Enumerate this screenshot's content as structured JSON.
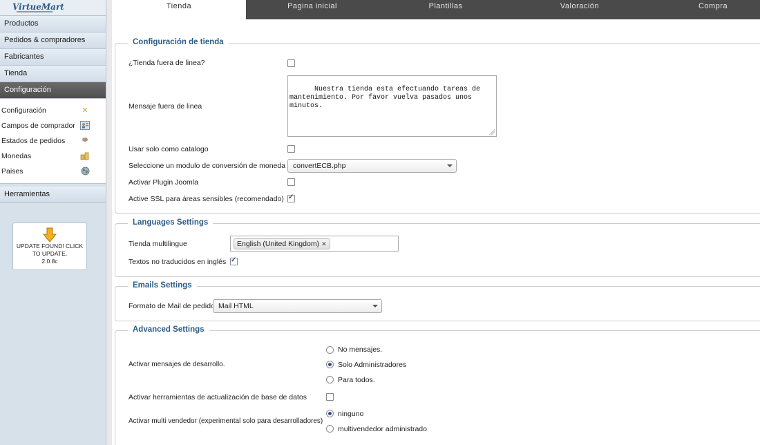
{
  "sidebar": {
    "logo": "VirtueMart",
    "menu": [
      {
        "label": "Productos"
      },
      {
        "label": "Pedidos & compradores"
      },
      {
        "label": "Fabricantes"
      },
      {
        "label": "Tienda"
      },
      {
        "label": "Configuración"
      }
    ],
    "submenu": [
      {
        "label": "Configuración",
        "icon": "tools-icon"
      },
      {
        "label": "Campos de comprador",
        "icon": "user-fields-icon"
      },
      {
        "label": "Estados de pedidos",
        "icon": "order-status-icon"
      },
      {
        "label": "Monedas",
        "icon": "coins-icon"
      },
      {
        "label": "Paises",
        "icon": "globe-icon"
      }
    ],
    "tools_label": "Herramientas",
    "update": {
      "line1": "UPDATE FOUND! CLICK",
      "line2": "TO UPDATE.",
      "version": "2.0.8c"
    }
  },
  "tabs": [
    {
      "label": "Tienda"
    },
    {
      "label": "Pagina inicial"
    },
    {
      "label": "Plantillas"
    },
    {
      "label": "Valoración"
    },
    {
      "label": "Compra"
    }
  ],
  "shop_config": {
    "legend": "Configuración de tienda",
    "offline_label": "¿Tienda fuera de linea?",
    "offline_checked": false,
    "offline_msg_label": "Mensaje fuera de linea",
    "offline_msg_value": "Nuestra tienda esta efectuando tareas de\nmantenimiento. Por favor vuelva pasados unos\nminutos.",
    "catalog_label": "Usar solo como catalogo",
    "catalog_checked": false,
    "currency_module_label": "Seleccione un modulo de conversión de moneda",
    "currency_module_value": "convertECB.php",
    "joomla_plugin_label": "Activar Plugin Joomla",
    "joomla_plugin_checked": false,
    "ssl_label": "Active SSL para áreas sensibles (recomendado)",
    "ssl_checked": true
  },
  "languages": {
    "legend": "Languages Settings",
    "multilingual_label": "Tienda multilingue",
    "selected_language": "English (United Kingdom)",
    "untranslated_label": "Textos no traducidos en inglés",
    "untranslated_checked": true
  },
  "emails": {
    "legend": "Emails Settings",
    "format_label": "Formato de Mail de pedido",
    "format_value": "Mail HTML"
  },
  "advanced": {
    "legend": "Advanced Settings",
    "dev_msgs_label": "Activar mensajes de desarrollo.",
    "dev_options": [
      "No mensajes.",
      "Solo Administradores",
      "Para todos."
    ],
    "dev_selected": 1,
    "db_tools_label": "Activar herramientas de actualización de base de datos",
    "db_tools_checked": false,
    "multivendor_label": "Activar multi vendedor (experimental solo para desarrolladores)",
    "multivendor_options": [
      "ninguno",
      "multivendedor administrado"
    ],
    "multivendor_selected": 0
  }
}
